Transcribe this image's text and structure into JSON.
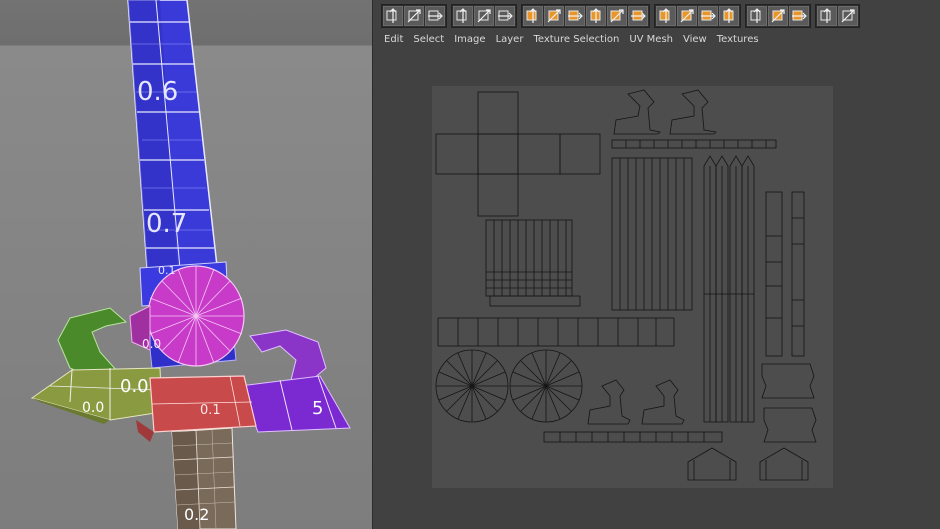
{
  "viewport": {
    "uv_labels": [
      "0.6",
      "0.7",
      "0.0",
      "0.1",
      "0.0",
      "0.1",
      "5",
      "0.0",
      "0.2"
    ]
  },
  "toolbar": {
    "groups": [
      [
        "selection-tool-icon",
        "rect-select-icon",
        "lasso-select-icon"
      ],
      [
        "grid-snap-icon",
        "frame-icon",
        "fit-selection-icon"
      ],
      [
        "align-top-icon",
        "align-bottom-icon",
        "align-vertical-icon",
        "align-horizontal-icon",
        "align-grid-icon",
        "stitch-icon"
      ],
      [
        "flip-horizontal-icon",
        "flip-vertical-icon",
        "distribute-horizontal-icon",
        "distribute-vertical-icon"
      ],
      [
        "move-icon",
        "relax-icon",
        "pack-icon"
      ],
      [
        "show-checker-icon",
        "hide-checker-icon"
      ]
    ]
  },
  "menu": {
    "items": [
      "Edit",
      "Select",
      "Image",
      "Layer",
      "Texture Selection",
      "UV Mesh",
      "View",
      "Textures"
    ]
  },
  "colors": {
    "accent": "#e8952a",
    "uv_background": "#4d4d4d",
    "uv_wire": "#151515"
  }
}
